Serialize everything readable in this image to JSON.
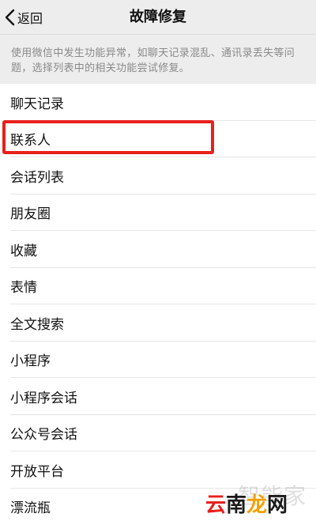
{
  "navbar": {
    "back_label": "返回",
    "title": "故障修复"
  },
  "description": "使用微信中发生功能异常，如聊天记录混乱、通讯录丢失等问题，选择列表中的相关功能尝试修复。",
  "list": {
    "items": [
      {
        "label": "聊天记录"
      },
      {
        "label": "联系人"
      },
      {
        "label": "会话列表"
      },
      {
        "label": "朋友圈"
      },
      {
        "label": "收藏"
      },
      {
        "label": "表情"
      },
      {
        "label": "全文搜索"
      },
      {
        "label": "小程序"
      },
      {
        "label": "小程序会话"
      },
      {
        "label": "公众号会话"
      },
      {
        "label": "开放平台"
      },
      {
        "label": "漂流瓶"
      }
    ],
    "highlighted_index": 1
  },
  "watermark": {
    "top": "智能家",
    "main": "云南龙网",
    "main_colors": [
      "#e8201c",
      "#1a1a1a",
      "#f0a000",
      "#1a1a1a"
    ]
  },
  "colors": {
    "highlight": "#e8201c",
    "navbar_bg": "#ededed",
    "description_text": "#8a8a8a"
  }
}
